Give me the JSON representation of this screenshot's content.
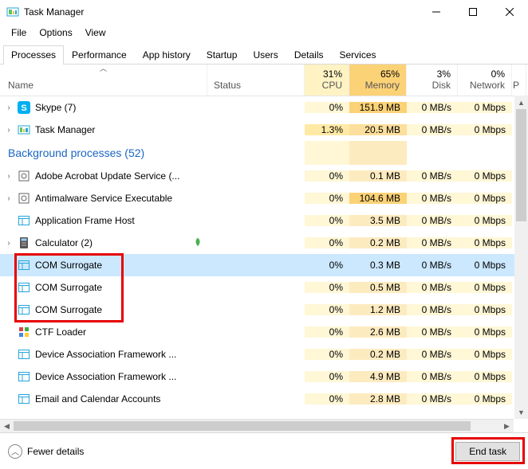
{
  "window": {
    "title": "Task Manager"
  },
  "menus": [
    "File",
    "Options",
    "View"
  ],
  "tabs": [
    "Processes",
    "Performance",
    "App history",
    "Startup",
    "Users",
    "Details",
    "Services"
  ],
  "active_tab": 0,
  "columns": {
    "name": "Name",
    "status": "Status",
    "cpu": {
      "pct": "31%",
      "label": "CPU"
    },
    "memory": {
      "pct": "65%",
      "label": "Memory"
    },
    "disk": {
      "pct": "3%",
      "label": "Disk"
    },
    "network": {
      "pct": "0%",
      "label": "Network"
    },
    "extra": "P"
  },
  "group_header": "Background processes (52)",
  "rows": [
    {
      "icon": "skype",
      "name": "Skype (7)",
      "expandable": true,
      "cpu": "0%",
      "mem": "151.9 MB",
      "disk": "0 MB/s",
      "net": "0 Mbps",
      "mem_heat": "hi"
    },
    {
      "icon": "taskmgr",
      "name": "Task Manager",
      "expandable": true,
      "cpu": "1.3%",
      "mem": "20.5 MB",
      "disk": "0 MB/s",
      "net": "0 Mbps",
      "cpu_heat": "med",
      "mem_heat": "med"
    },
    {
      "group": true
    },
    {
      "icon": "service",
      "name": "Adobe Acrobat Update Service (...",
      "expandable": true,
      "cpu": "0%",
      "mem": "0.1 MB",
      "disk": "0 MB/s",
      "net": "0 Mbps",
      "mem_heat": "lo"
    },
    {
      "icon": "service",
      "name": "Antimalware Service Executable",
      "expandable": true,
      "cpu": "0%",
      "mem": "104.6 MB",
      "disk": "0 MB/s",
      "net": "0 Mbps",
      "mem_heat": "hi"
    },
    {
      "icon": "app",
      "name": "Application Frame Host",
      "expandable": false,
      "cpu": "0%",
      "mem": "3.5 MB",
      "disk": "0 MB/s",
      "net": "0 Mbps",
      "mem_heat": "lo"
    },
    {
      "icon": "calc",
      "name": "Calculator (2)",
      "expandable": true,
      "leaf": true,
      "cpu": "0%",
      "mem": "0.2 MB",
      "disk": "0 MB/s",
      "net": "0 Mbps",
      "mem_heat": "lo"
    },
    {
      "icon": "app",
      "name": "COM Surrogate",
      "expandable": false,
      "cpu": "0%",
      "mem": "0.3 MB",
      "disk": "0 MB/s",
      "net": "0 Mbps",
      "mem_heat": "lo",
      "selected": true
    },
    {
      "icon": "app",
      "name": "COM Surrogate",
      "expandable": false,
      "cpu": "0%",
      "mem": "0.5 MB",
      "disk": "0 MB/s",
      "net": "0 Mbps",
      "mem_heat": "lo"
    },
    {
      "icon": "app",
      "name": "COM Surrogate",
      "expandable": false,
      "cpu": "0%",
      "mem": "1.2 MB",
      "disk": "0 MB/s",
      "net": "0 Mbps",
      "mem_heat": "lo"
    },
    {
      "icon": "ctf",
      "name": "CTF Loader",
      "expandable": false,
      "cpu": "0%",
      "mem": "2.6 MB",
      "disk": "0 MB/s",
      "net": "0 Mbps",
      "mem_heat": "lo"
    },
    {
      "icon": "app",
      "name": "Device Association Framework ...",
      "expandable": false,
      "cpu": "0%",
      "mem": "0.2 MB",
      "disk": "0 MB/s",
      "net": "0 Mbps",
      "mem_heat": "lo"
    },
    {
      "icon": "app",
      "name": "Device Association Framework ...",
      "expandable": false,
      "cpu": "0%",
      "mem": "4.9 MB",
      "disk": "0 MB/s",
      "net": "0 Mbps",
      "mem_heat": "lo"
    },
    {
      "icon": "app",
      "name": "Email and Calendar Accounts",
      "expandable": false,
      "cpu": "0%",
      "mem": "2.8 MB",
      "disk": "0 MB/s",
      "net": "0 Mbps",
      "mem_heat": "lo"
    }
  ],
  "footer": {
    "fewer": "Fewer details",
    "end_task": "End task"
  }
}
